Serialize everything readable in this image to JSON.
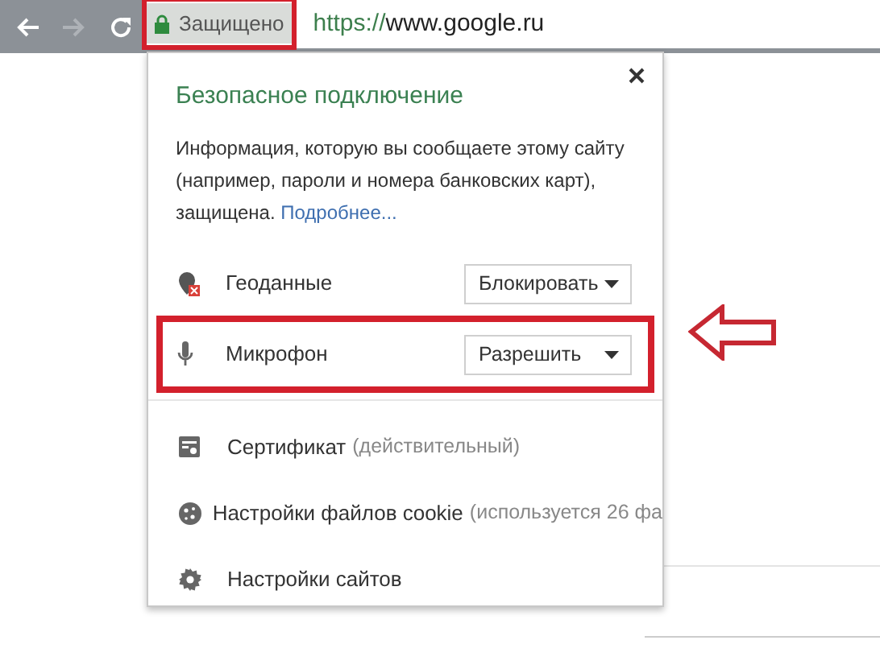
{
  "toolbar": {
    "nav_buttons": [
      {
        "kind": "back",
        "disabled": false
      },
      {
        "kind": "forward",
        "disabled": true
      },
      {
        "kind": "reload",
        "disabled": false
      }
    ],
    "address_bar": {
      "security_label": "Защищено",
      "url_scheme": "https://",
      "url_host": "www.google.ru"
    }
  },
  "popup": {
    "title": "Безопасное подключение",
    "description": "Информация, которую вы сообщаете этому сайту (например, пароли и номера банковских карт), защищена.",
    "link": "Подробнее...",
    "permissions": [
      {
        "kind": "location",
        "label": "Геоданные",
        "value": "Блокировать",
        "highlighted": false
      },
      {
        "kind": "microphone",
        "label": "Микрофон",
        "value": "Разрешить",
        "highlighted": true
      }
    ],
    "links": [
      {
        "kind": "certificate",
        "label": "Сертификат",
        "detail": "(действительный)"
      },
      {
        "kind": "cookie",
        "label": "Настройки файлов cookie",
        "detail": "(используется 26 фа"
      },
      {
        "kind": "settings",
        "label": "Настройки сайтов"
      }
    ]
  }
}
